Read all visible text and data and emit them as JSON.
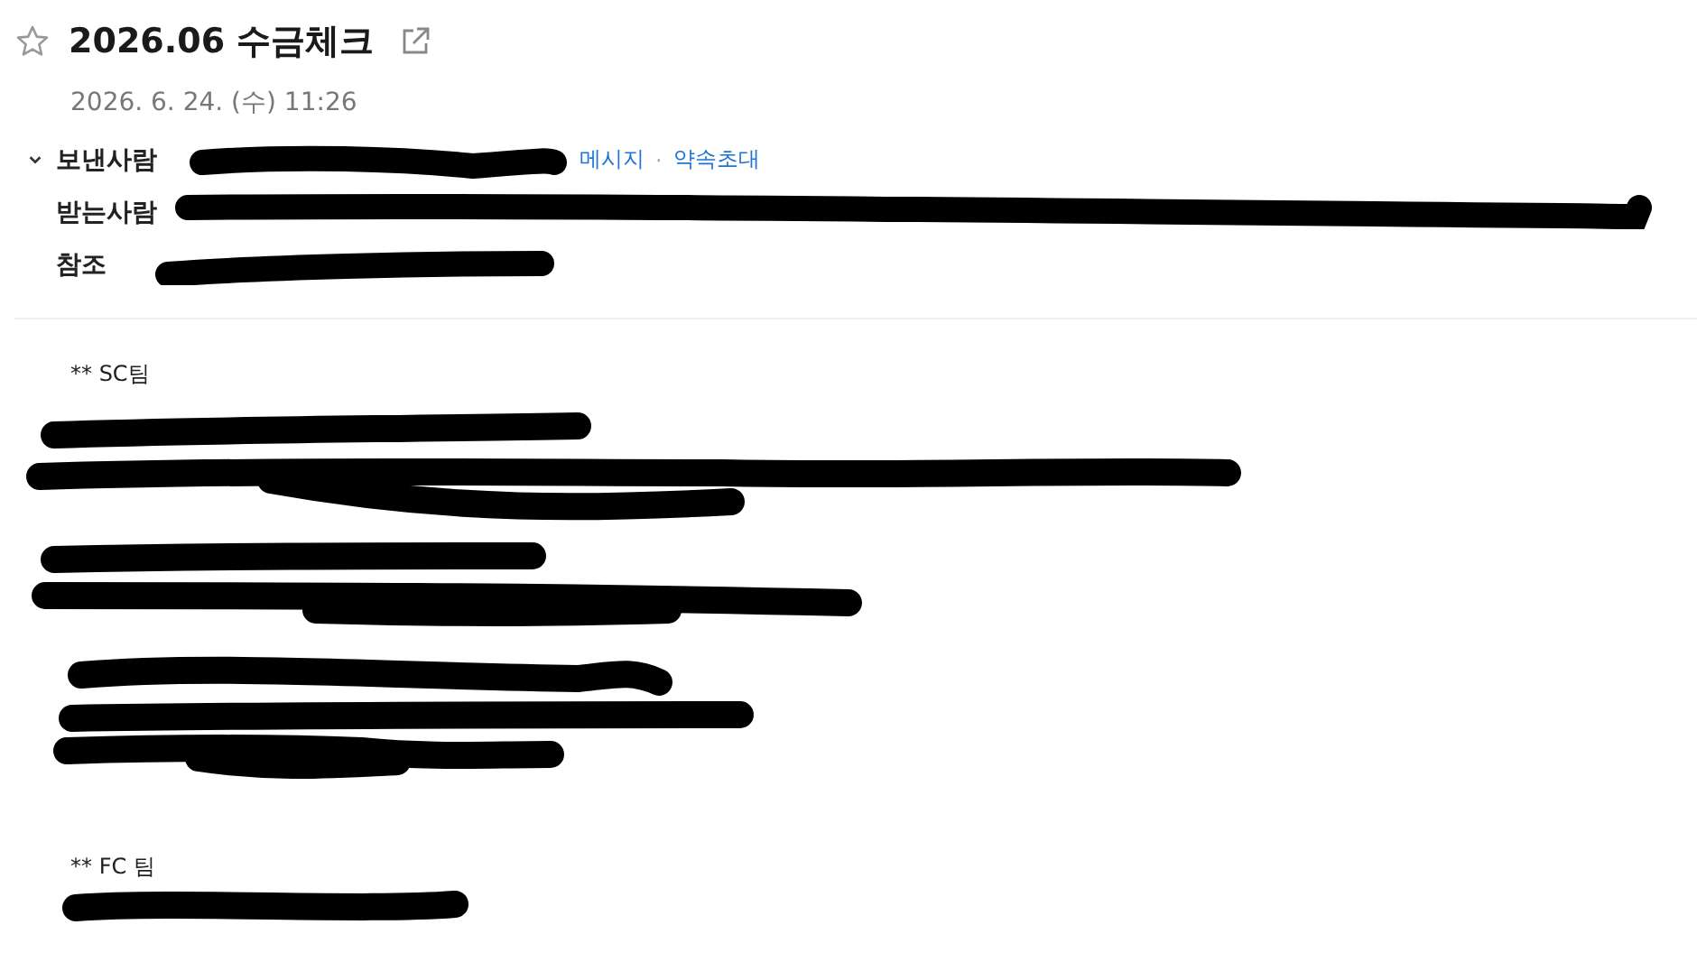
{
  "mail": {
    "title": "2026.06 수금체크",
    "starred": false,
    "date": "2026. 6. 24. (수) 11:26",
    "expanded": true,
    "headers": [
      {
        "label": "보낸사람",
        "links": [
          "메시지",
          "약속초대"
        ],
        "separator": "·"
      },
      {
        "label": "받는사람"
      },
      {
        "label": "참조"
      }
    ]
  },
  "body": {
    "sections": [
      {
        "heading": "** SC팀"
      },
      {
        "heading": "** FC  팀"
      }
    ]
  }
}
